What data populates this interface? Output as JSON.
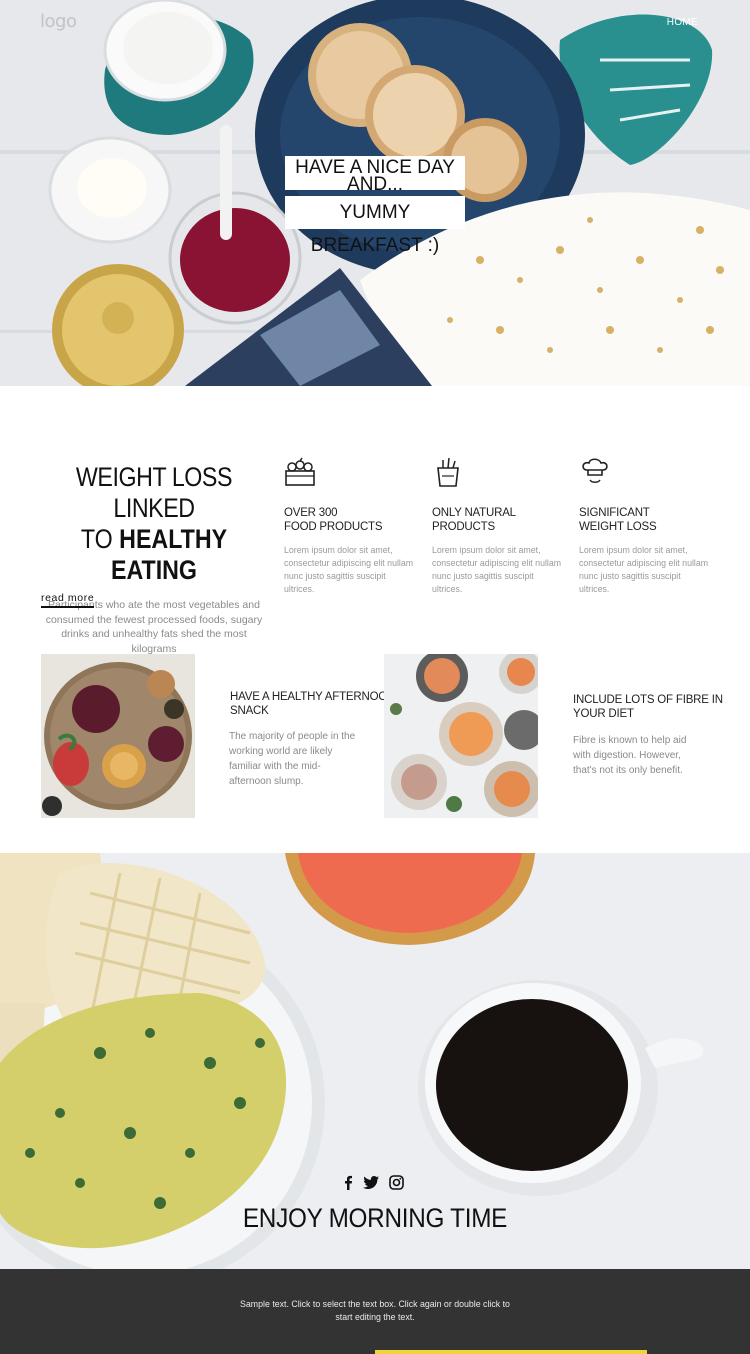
{
  "header": {
    "logo": "logo",
    "nav_home": "HOME"
  },
  "hero": {
    "title_line1": "HAVE A NICE DAY AND...",
    "title_line2": "YUMMY BREAKFAST :)"
  },
  "intro": {
    "heading_line1": "WEIGHT LOSS LINKED",
    "heading_line2_prefix": "TO ",
    "heading_line2_bold": "HEALTHY EATING",
    "text": "Participants who ate the most vegetables and consumed the fewest processed foods, sugary drinks and unhealthy fats shed the most kilograms",
    "read_more": "read more"
  },
  "features": [
    {
      "icon": "food-crate-icon",
      "title_line1": "OVER 300",
      "title_line2": "FOOD PRODUCTS",
      "text": "Lorem ipsum dolor sit amet, consectetur adipiscing elit nullam nunc justo sagittis suscipit ultrices."
    },
    {
      "icon": "grocery-bag-icon",
      "title_line1": "ONLY NATURAL",
      "title_line2": "PRODUCTS",
      "text": "Lorem ipsum dolor sit amet, consectetur adipiscing elit nullam nunc justo sagittis suscipit ultrices."
    },
    {
      "icon": "chef-icon",
      "title_line1": "SIGNIFICANT",
      "title_line2": "WEIGHT LOSS",
      "text": "Lorem ipsum dolor sit amet, consectetur adipiscing elit nullam nunc justo sagittis suscipit ultrices."
    }
  ],
  "cards": [
    {
      "title_line1": "HAVE A HEALTHY AFTERNOON",
      "title_line2": "SNACK",
      "text": "The majority of people in the working world are likely familiar with the mid-afternoon slump."
    },
    {
      "title_line1": "INCLUDE LOTS OF FIBRE IN",
      "title_line2": "YOUR DIET",
      "text": "Fibre is known to help aid with digestion. However, that's not its only benefit."
    }
  ],
  "morning": {
    "social": [
      "facebook-icon",
      "twitter-icon",
      "instagram-icon"
    ],
    "title": "ENJOY MORNING TIME"
  },
  "footer": {
    "text": "Sample text. Click to select the text box. Click again or double click to start editing the text."
  },
  "colors": {
    "footer_bg": "#333333",
    "accent": "#f0d23a"
  }
}
